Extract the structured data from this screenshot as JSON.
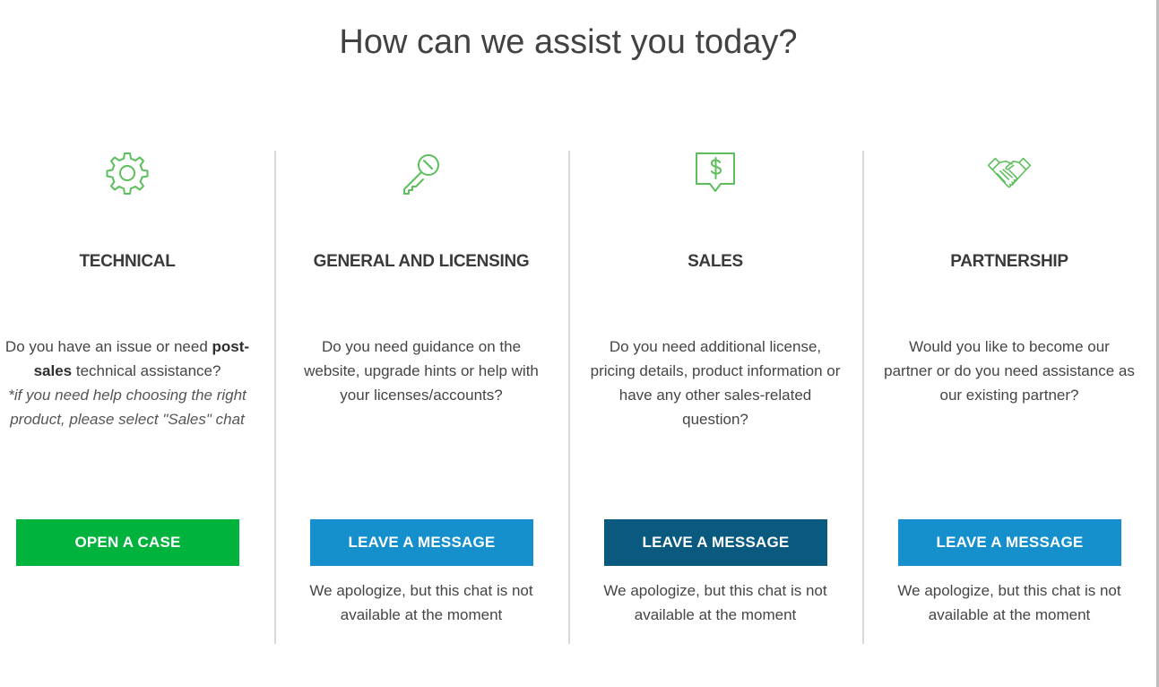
{
  "heading": "How can we assist you today?",
  "accent_color": "#5cbf5c",
  "cards": [
    {
      "icon": "gear-icon",
      "title": "TECHNICAL",
      "desc_part1": "Do you have an issue or need",
      "desc_bold": "post-sales",
      "desc_part2": "technical assistance?",
      "desc_note": "*if you need help choosing the right product, please select \"Sales\" chat",
      "button_label": "OPEN A CASE",
      "button_color": "#00b33c"
    },
    {
      "icon": "key-icon",
      "title": "GENERAL AND LICENSING",
      "description": "Do you need guidance on the website, upgrade hints or help with your licenses/accounts?",
      "button_label": "LEAVE A MESSAGE",
      "button_color": "#1690cd",
      "status": "We apologize, but this chat is not available at the moment"
    },
    {
      "icon": "dollar-chat-icon",
      "title": "SALES",
      "description": "Do you need additional license, pricing details, product information or have any other sales-related question?",
      "button_label": "LEAVE A MESSAGE",
      "button_color": "#0a5a80",
      "status": "We apologize, but this chat is not available at the moment"
    },
    {
      "icon": "handshake-icon",
      "title": "PARTNERSHIP",
      "description": "Would you like to become our partner or do you need assistance as our existing partner?",
      "button_label": "LEAVE A MESSAGE",
      "button_color": "#1690cd",
      "status": "We apologize, but this chat is not available at the moment"
    }
  ]
}
